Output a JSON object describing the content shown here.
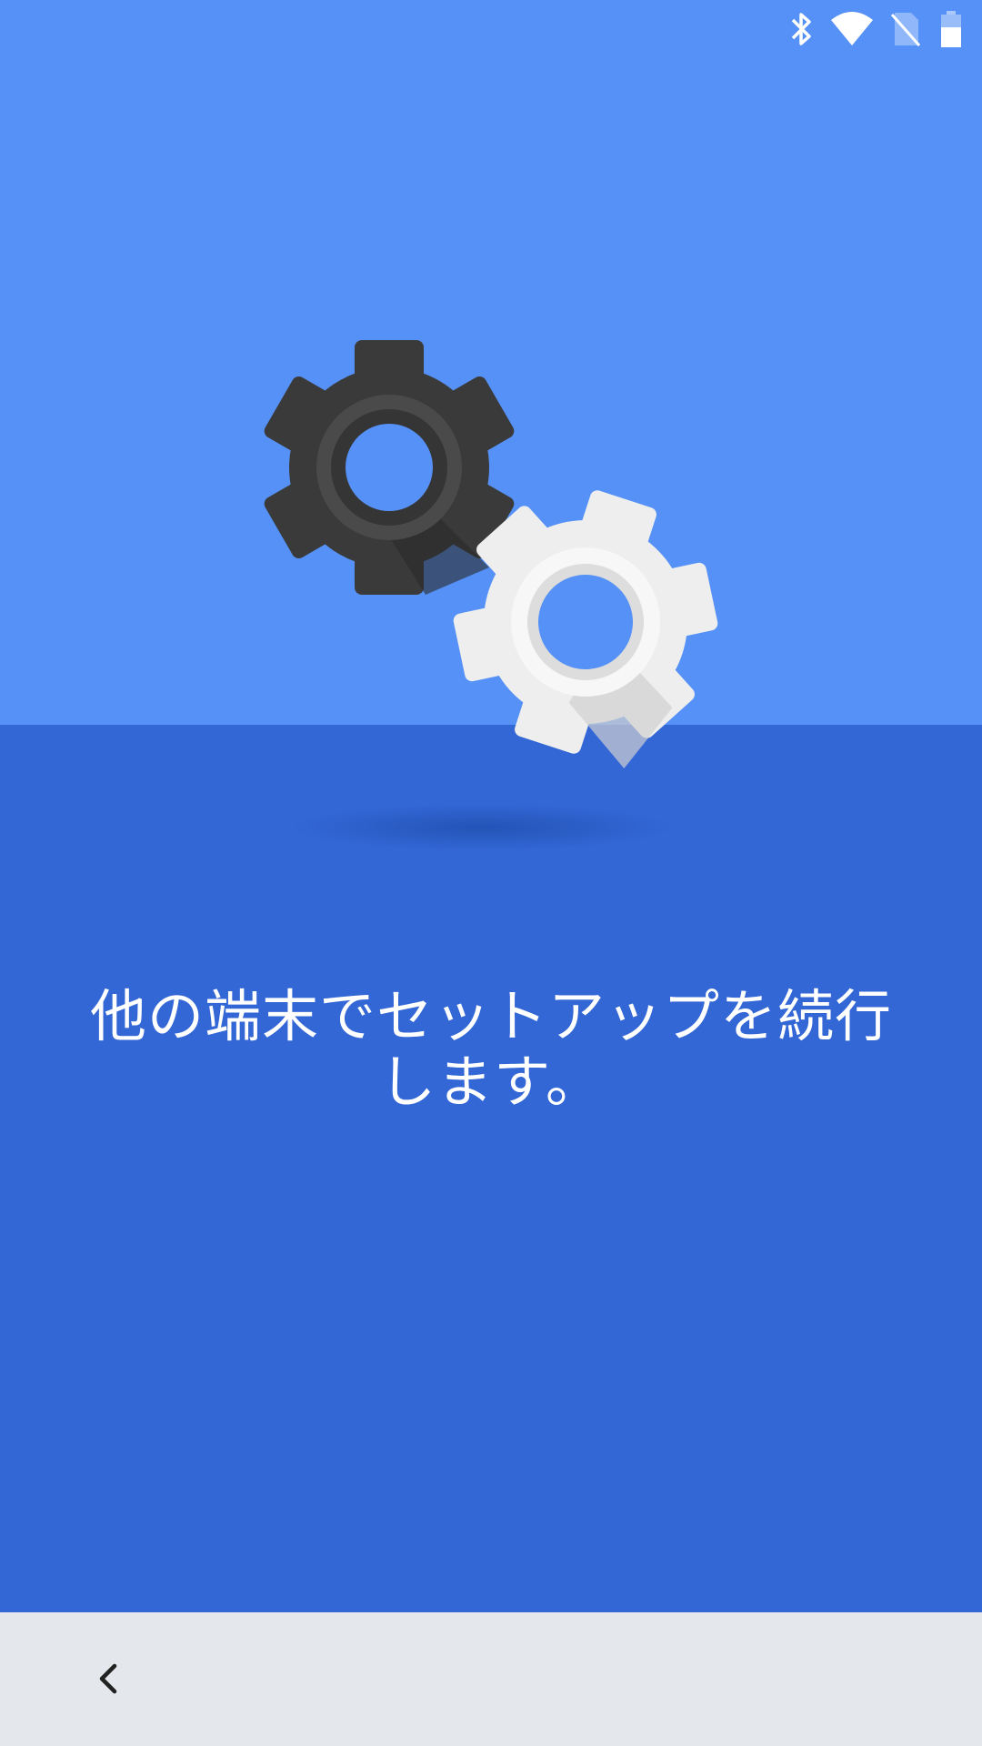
{
  "colors": {
    "top_background": "#5591f6",
    "bottom_background": "#3367d6",
    "nav_bar_background": "#e4e7eb",
    "text": "#ffffff",
    "gear_dark": "#3a3a3a",
    "gear_light": "#eeeeee"
  },
  "status_bar": {
    "icons": [
      "bluetooth-icon",
      "wifi-icon",
      "no-sim-icon",
      "battery-icon"
    ]
  },
  "illustration": {
    "icons": [
      "dark-gear-icon",
      "light-gear-icon",
      "gear-shadow"
    ]
  },
  "message": {
    "line1": "他の端末でセットアップを続行",
    "line2": "します。"
  },
  "nav_bar": {
    "back_icon": "chevron-left-icon"
  }
}
